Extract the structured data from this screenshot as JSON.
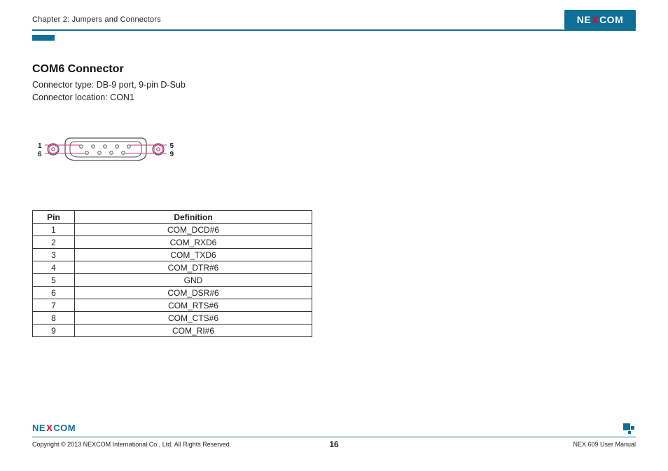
{
  "header": {
    "chapter": "Chapter 2: Jumpers and Connectors",
    "brand": "NEXCOM"
  },
  "section": {
    "title": "COM6 Connector",
    "type_line": "Connector type: DB-9 port, 9-pin D-Sub",
    "loc_line": "Connector location: CON1"
  },
  "diagram": {
    "pin_labels": {
      "tl": "1",
      "bl": "6",
      "tr": "5",
      "br": "9"
    }
  },
  "table": {
    "headers": [
      "Pin",
      "Definition"
    ],
    "rows": [
      {
        "pin": "1",
        "def": "COM_DCD#6"
      },
      {
        "pin": "2",
        "def": "COM_RXD6"
      },
      {
        "pin": "3",
        "def": "COM_TXD6"
      },
      {
        "pin": "4",
        "def": "COM_DTR#6"
      },
      {
        "pin": "5",
        "def": "GND"
      },
      {
        "pin": "6",
        "def": "COM_DSR#6"
      },
      {
        "pin": "7",
        "def": "COM_RTS#6"
      },
      {
        "pin": "8",
        "def": "COM_CTS#6"
      },
      {
        "pin": "9",
        "def": "COM_RI#6"
      }
    ]
  },
  "footer": {
    "copyright": "Copyright © 2013 NEXCOM International Co., Ltd. All Rights Reserved.",
    "page": "16",
    "doc": "NEX 609 User Manual"
  }
}
